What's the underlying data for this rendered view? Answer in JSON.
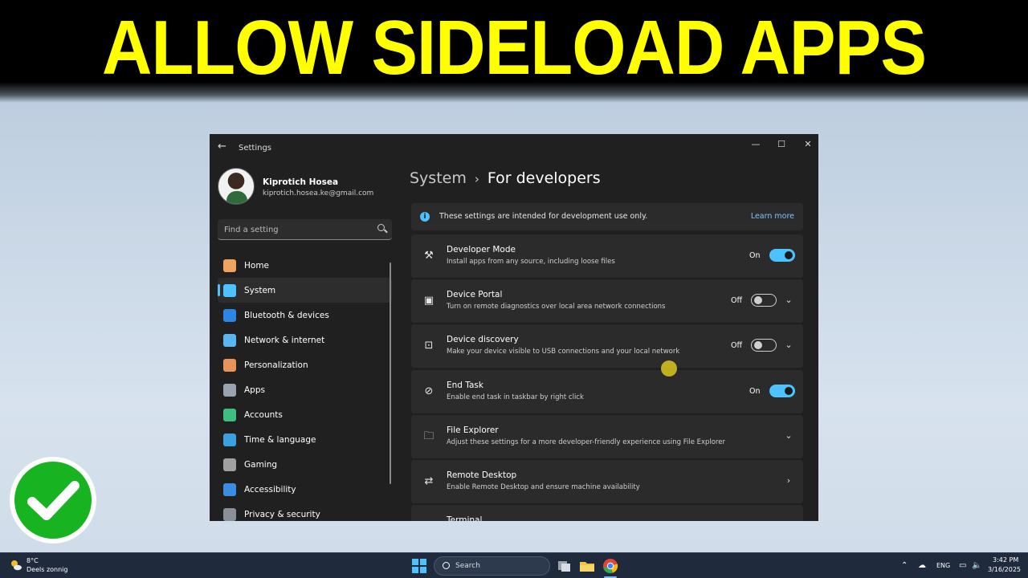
{
  "banner": {
    "title": "ALLOW SIDELOAD APPS"
  },
  "window": {
    "app_title": "Settings",
    "controls": {
      "minimize": "—",
      "maximize": "☐",
      "close": "✕"
    }
  },
  "profile": {
    "name": "Kiprotich Hosea",
    "email": "kiprotich.hosea.ke@gmail.com"
  },
  "search": {
    "placeholder": "Find a setting"
  },
  "nav": [
    {
      "label": "Home",
      "icon": "home-icon",
      "color": "#f0a35e",
      "active": false
    },
    {
      "label": "System",
      "icon": "display-icon",
      "color": "#4cc2ff",
      "active": true
    },
    {
      "label": "Bluetooth & devices",
      "icon": "bluetooth-icon",
      "color": "#2b87e3",
      "active": false
    },
    {
      "label": "Network & internet",
      "icon": "wifi-icon",
      "color": "#5ab5f0",
      "active": false
    },
    {
      "label": "Personalization",
      "icon": "brush-icon",
      "color": "#e8935a",
      "active": false
    },
    {
      "label": "Apps",
      "icon": "apps-icon",
      "color": "#9aa4b1",
      "active": false
    },
    {
      "label": "Accounts",
      "icon": "person-icon",
      "color": "#3fbf7f",
      "active": false
    },
    {
      "label": "Time & language",
      "icon": "globe-clock-icon",
      "color": "#3aa0e0",
      "active": false
    },
    {
      "label": "Gaming",
      "icon": "gamepad-icon",
      "color": "#a0a0a0",
      "active": false
    },
    {
      "label": "Accessibility",
      "icon": "accessibility-icon",
      "color": "#3a8de0",
      "active": false
    },
    {
      "label": "Privacy & security",
      "icon": "shield-icon",
      "color": "#8a8f99",
      "active": false
    }
  ],
  "breadcrumb": {
    "parent": "System",
    "separator": "›",
    "current": "For developers"
  },
  "info": {
    "text": "These settings are intended for development use only.",
    "link": "Learn more"
  },
  "cards": [
    {
      "icon": "developer-tools-icon",
      "glyph": "⚒",
      "title": "Developer Mode",
      "subtitle": "Install apps from any source, including loose files",
      "state": "On",
      "toggle": "on",
      "chevron": ""
    },
    {
      "icon": "device-portal-icon",
      "glyph": "▣",
      "title": "Device Portal",
      "subtitle": "Turn on remote diagnostics over local area network connections",
      "state": "Off",
      "toggle": "off",
      "chevron": "⌄"
    },
    {
      "icon": "device-discovery-icon",
      "glyph": "⊡",
      "title": "Device discovery",
      "subtitle": "Make your device visible to USB connections and your local network",
      "state": "Off",
      "toggle": "off",
      "chevron": "⌄"
    },
    {
      "icon": "end-task-icon",
      "glyph": "⊘",
      "title": "End Task",
      "subtitle": "Enable end task in taskbar by right click",
      "state": "On",
      "toggle": "on",
      "chevron": ""
    },
    {
      "icon": "folder-icon",
      "glyph": "🗀",
      "title": "File Explorer",
      "subtitle": "Adjust these settings for a more developer-friendly experience using File Explorer",
      "state": "",
      "toggle": "",
      "chevron": "⌄"
    },
    {
      "icon": "remote-desktop-icon",
      "glyph": "⇄",
      "title": "Remote Desktop",
      "subtitle": "Enable Remote Desktop and ensure machine availability",
      "state": "",
      "toggle": "",
      "chevron": "›"
    },
    {
      "icon": "terminal-icon",
      "glyph": ">_",
      "title": "Terminal",
      "subtitle": "",
      "state": "",
      "toggle": "",
      "chevron": ""
    }
  ],
  "taskbar": {
    "weather_temp": "8°C",
    "weather_desc": "Deels zonnig",
    "search_label": "Search",
    "language": "ENG",
    "time": "3:42 PM",
    "date": "3/16/2025"
  },
  "colors": {
    "accent": "#4cc2ff",
    "banner_text": "#ffff00",
    "check_green": "#17b320"
  }
}
